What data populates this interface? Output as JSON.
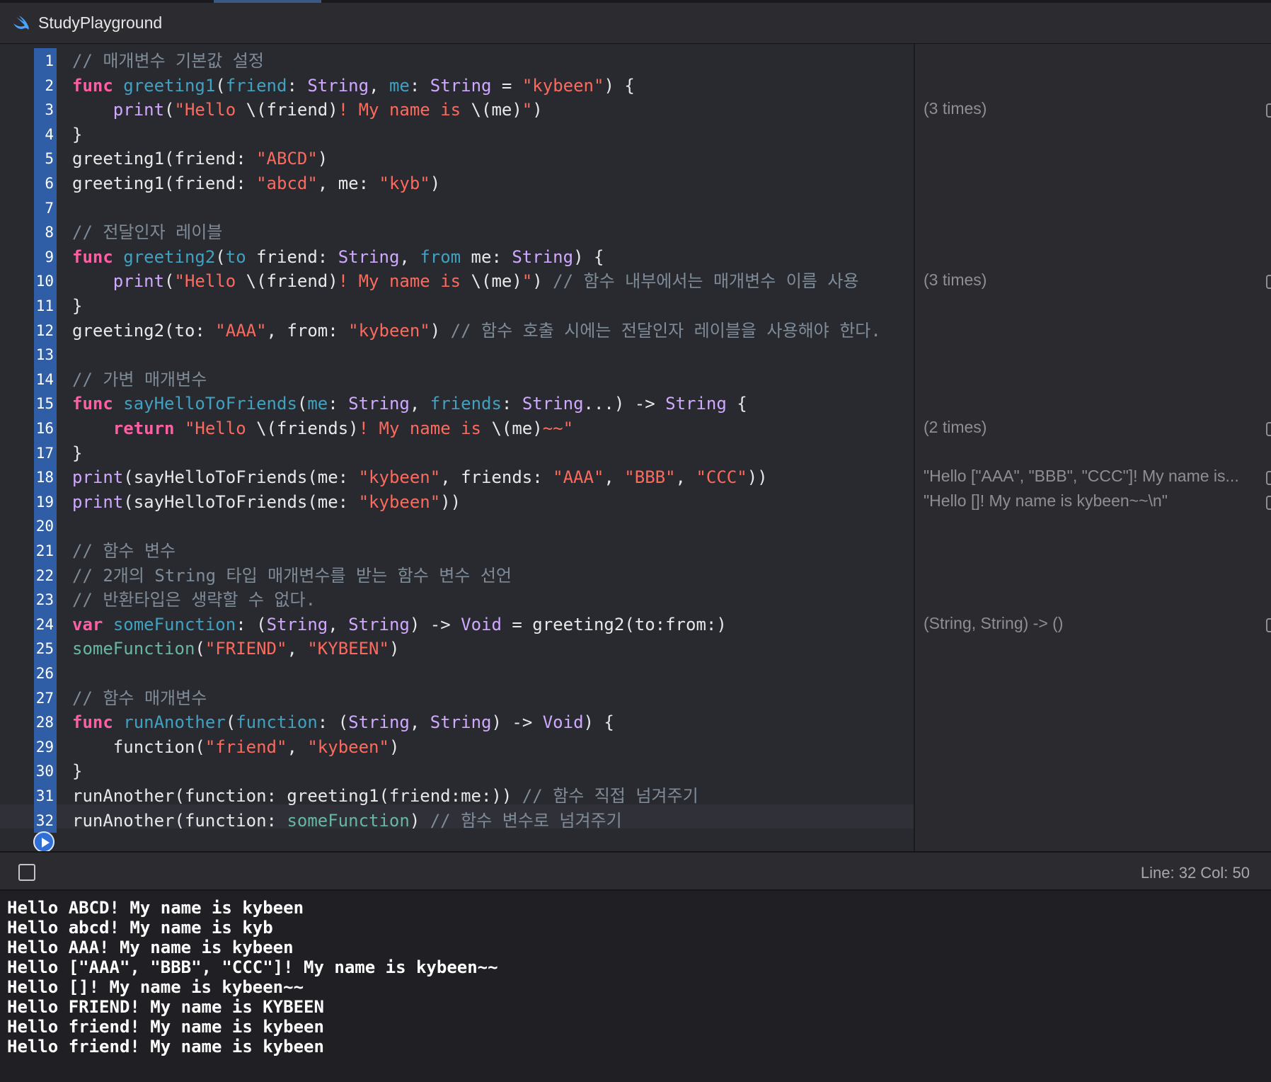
{
  "window": {
    "title": "StudyPlayground"
  },
  "editor": {
    "line_numbers": [
      "1",
      "2",
      "3",
      "4",
      "5",
      "6",
      "7",
      "8",
      "9",
      "10",
      "11",
      "12",
      "13",
      "14",
      "15",
      "16",
      "17",
      "18",
      "19",
      "20",
      "21",
      "22",
      "23",
      "24",
      "25",
      "26",
      "27",
      "28",
      "29",
      "30",
      "31",
      "32"
    ],
    "lines": [
      [
        [
          "cm",
          "// 매개변수 기본값 설정"
        ]
      ],
      [
        [
          "kw",
          "func"
        ],
        [
          "pl",
          " "
        ],
        [
          "dec",
          "greeting1"
        ],
        [
          "pl",
          "("
        ],
        [
          "dec",
          "friend"
        ],
        [
          "pl",
          ": "
        ],
        [
          "ty",
          "String"
        ],
        [
          "pl",
          ", "
        ],
        [
          "dec",
          "me"
        ],
        [
          "pl",
          ": "
        ],
        [
          "ty",
          "String"
        ],
        [
          "pl",
          " = "
        ],
        [
          "str",
          "\"kybeen\""
        ],
        [
          "pl",
          ") {"
        ]
      ],
      [
        [
          "pl",
          "    "
        ],
        [
          "ty",
          "print"
        ],
        [
          "pl",
          "("
        ],
        [
          "str",
          "\"Hello "
        ],
        [
          "pl",
          "\\(friend)"
        ],
        [
          "str",
          "! My name is "
        ],
        [
          "pl",
          "\\(me)"
        ],
        [
          "str",
          "\""
        ],
        [
          "pl",
          ")"
        ]
      ],
      [
        [
          "pl",
          "}"
        ]
      ],
      [
        [
          "pl",
          "greeting1(friend: "
        ],
        [
          "str",
          "\"ABCD\""
        ],
        [
          "pl",
          ")"
        ]
      ],
      [
        [
          "pl",
          "greeting1(friend: "
        ],
        [
          "str",
          "\"abcd\""
        ],
        [
          "pl",
          ", me: "
        ],
        [
          "str",
          "\"kyb\""
        ],
        [
          "pl",
          ")"
        ]
      ],
      [],
      [
        [
          "cm",
          "// 전달인자 레이블"
        ]
      ],
      [
        [
          "kw",
          "func"
        ],
        [
          "pl",
          " "
        ],
        [
          "dec",
          "greeting2"
        ],
        [
          "pl",
          "("
        ],
        [
          "dec",
          "to"
        ],
        [
          "pl",
          " friend: "
        ],
        [
          "ty",
          "String"
        ],
        [
          "pl",
          ", "
        ],
        [
          "dec",
          "from"
        ],
        [
          "pl",
          " me: "
        ],
        [
          "ty",
          "String"
        ],
        [
          "pl",
          ") {"
        ]
      ],
      [
        [
          "pl",
          "    "
        ],
        [
          "ty",
          "print"
        ],
        [
          "pl",
          "("
        ],
        [
          "str",
          "\"Hello "
        ],
        [
          "pl",
          "\\(friend)"
        ],
        [
          "str",
          "! My name is "
        ],
        [
          "pl",
          "\\(me)"
        ],
        [
          "str",
          "\""
        ],
        [
          "pl",
          ") "
        ],
        [
          "cm",
          "// 함수 내부에서는 매개변수 이름 사용"
        ]
      ],
      [
        [
          "pl",
          "}"
        ]
      ],
      [
        [
          "pl",
          "greeting2(to: "
        ],
        [
          "str",
          "\"AAA\""
        ],
        [
          "pl",
          ", from: "
        ],
        [
          "str",
          "\"kybeen\""
        ],
        [
          "pl",
          ") "
        ],
        [
          "cm",
          "// 함수 호출 시에는 전달인자 레이블을 사용해야 한다."
        ]
      ],
      [],
      [
        [
          "cm",
          "// 가변 매개변수"
        ]
      ],
      [
        [
          "kw",
          "func"
        ],
        [
          "pl",
          " "
        ],
        [
          "dec",
          "sayHelloToFriends"
        ],
        [
          "pl",
          "("
        ],
        [
          "dec",
          "me"
        ],
        [
          "pl",
          ": "
        ],
        [
          "ty",
          "String"
        ],
        [
          "pl",
          ", "
        ],
        [
          "dec",
          "friends"
        ],
        [
          "pl",
          ": "
        ],
        [
          "ty",
          "String"
        ],
        [
          "pl",
          "...) -> "
        ],
        [
          "ty",
          "String"
        ],
        [
          "pl",
          " {"
        ]
      ],
      [
        [
          "pl",
          "    "
        ],
        [
          "kw",
          "return"
        ],
        [
          "pl",
          " "
        ],
        [
          "str",
          "\"Hello "
        ],
        [
          "pl",
          "\\(friends)"
        ],
        [
          "str",
          "! My name is "
        ],
        [
          "pl",
          "\\(me)"
        ],
        [
          "str",
          "~~\""
        ]
      ],
      [
        [
          "pl",
          "}"
        ]
      ],
      [
        [
          "ty",
          "print"
        ],
        [
          "pl",
          "(sayHelloToFriends(me: "
        ],
        [
          "str",
          "\"kybeen\""
        ],
        [
          "pl",
          ", friends: "
        ],
        [
          "str",
          "\"AAA\""
        ],
        [
          "pl",
          ", "
        ],
        [
          "str",
          "\"BBB\""
        ],
        [
          "pl",
          ", "
        ],
        [
          "str",
          "\"CCC\""
        ],
        [
          "pl",
          "))"
        ]
      ],
      [
        [
          "ty",
          "print"
        ],
        [
          "pl",
          "(sayHelloToFriends(me: "
        ],
        [
          "str",
          "\"kybeen\""
        ],
        [
          "pl",
          "))"
        ]
      ],
      [],
      [
        [
          "cm",
          "// 함수 변수"
        ]
      ],
      [
        [
          "cm",
          "// 2개의 String 타입 매개변수를 받는 함수 변수 선언"
        ]
      ],
      [
        [
          "cm",
          "// 반환타입은 생략할 수 없다."
        ]
      ],
      [
        [
          "kw",
          "var"
        ],
        [
          "pl",
          " "
        ],
        [
          "dec",
          "someFunction"
        ],
        [
          "pl",
          ": ("
        ],
        [
          "ty",
          "String"
        ],
        [
          "pl",
          ", "
        ],
        [
          "ty",
          "String"
        ],
        [
          "pl",
          ") -> "
        ],
        [
          "ty",
          "Void"
        ],
        [
          "pl",
          " = greeting2(to:from:)"
        ]
      ],
      [
        [
          "ut",
          "someFunction"
        ],
        [
          "pl",
          "("
        ],
        [
          "str",
          "\"FRIEND\""
        ],
        [
          "pl",
          ", "
        ],
        [
          "str",
          "\"KYBEEN\""
        ],
        [
          "pl",
          ")"
        ]
      ],
      [],
      [
        [
          "cm",
          "// 함수 매개변수"
        ]
      ],
      [
        [
          "kw",
          "func"
        ],
        [
          "pl",
          " "
        ],
        [
          "dec",
          "runAnother"
        ],
        [
          "pl",
          "("
        ],
        [
          "dec",
          "function"
        ],
        [
          "pl",
          ": ("
        ],
        [
          "ty",
          "String"
        ],
        [
          "pl",
          ", "
        ],
        [
          "ty",
          "String"
        ],
        [
          "pl",
          ") -> "
        ],
        [
          "ty",
          "Void"
        ],
        [
          "pl",
          ") {"
        ]
      ],
      [
        [
          "pl",
          "    function("
        ],
        [
          "str",
          "\"friend\""
        ],
        [
          "pl",
          ", "
        ],
        [
          "str",
          "\"kybeen\""
        ],
        [
          "pl",
          ")"
        ]
      ],
      [
        [
          "pl",
          "}"
        ]
      ],
      [
        [
          "pl",
          "runAnother(function: greeting1(friend:me:)) "
        ],
        [
          "cm",
          "// 함수 직접 넘겨주기"
        ]
      ],
      [
        [
          "pl",
          "runAnother(function: "
        ],
        [
          "ut",
          "someFunction"
        ],
        [
          "pl",
          ") "
        ],
        [
          "cm",
          "// 함수 변수로 넘겨주기"
        ]
      ]
    ]
  },
  "results": [
    {
      "line": 3,
      "text": "(3 times)"
    },
    {
      "line": 10,
      "text": "(3 times)"
    },
    {
      "line": 16,
      "text": "(2 times)"
    },
    {
      "line": 18,
      "text": "\"Hello [\"AAA\", \"BBB\", \"CCC\"]! My name is..."
    },
    {
      "line": 19,
      "text": "\"Hello []! My name is kybeen~~\\n\""
    },
    {
      "line": 24,
      "text": "(String, String) -> ()"
    }
  ],
  "status": {
    "cursor": "Line: 32  Col: 50"
  },
  "console": {
    "output": [
      "Hello ABCD! My name is kybeen",
      "Hello abcd! My name is kyb",
      "Hello AAA! My name is kybeen",
      "Hello [\"AAA\", \"BBB\", \"CCC\"]! My name is kybeen~~",
      "Hello []! My name is kybeen~~",
      "Hello FRIEND! My name is KYBEEN",
      "Hello friend! My name is kybeen",
      "Hello friend! My name is kybeen"
    ]
  },
  "colors": {
    "keyword": "#fc5fa3",
    "string": "#fc6a5d",
    "comment": "#7f8c98",
    "type": "#d0a8ff",
    "declaration": "#41a1c0",
    "gutter": "#2f5ea6"
  },
  "icons": [
    "swift-logo-icon",
    "run-icon",
    "console-toggle-icon",
    "quick-look-icon"
  ]
}
